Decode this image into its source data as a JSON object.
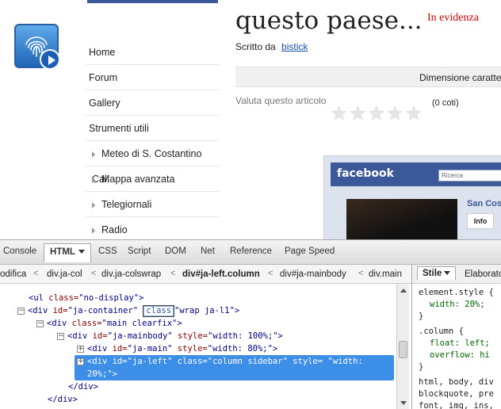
{
  "page": {
    "article_title": "questo paese...",
    "featured_label": "In evidenza",
    "author_prefix": "Scritto da",
    "author_name": "bistick",
    "font_size_label": "Dimensione caratte",
    "rating_label": "Valuta questo articolo",
    "rating_value": 0,
    "rating_max": 5,
    "votes_label": "(0 coti)",
    "menu": [
      {
        "label": "Home",
        "sub": false
      },
      {
        "label": "Forum",
        "sub": false
      },
      {
        "label": "Gallery",
        "sub": false
      },
      {
        "label": "Strumenti utili",
        "sub": false
      },
      {
        "label": "Meteo di S. Costantino Cal.",
        "sub": true
      },
      {
        "label": "Mappa avanzata",
        "sub": true
      },
      {
        "label": "Telegiornali",
        "sub": true
      },
      {
        "label": "Radio",
        "sub": true
      }
    ],
    "facebook": {
      "logo": "facebook",
      "search_placeholder": "Ricerca",
      "profile_name": "San Cos",
      "info_tab": "Info"
    }
  },
  "firebug": {
    "tabs": [
      "Console",
      "HTML",
      "CSS",
      "Script",
      "DOM",
      "Net",
      "Reference",
      "Page Speed"
    ],
    "active_tab": "HTML",
    "breadcrumbs": [
      "odifica",
      "div.ja-col",
      "div.ja-colswrap",
      "div#ja-left.column",
      "div#ja-mainbody",
      "div.main"
    ],
    "current_crumb": "div#ja-left.column",
    "side_tabs": [
      "Stile",
      "Elaborato"
    ],
    "active_side_tab": "Stile",
    "html_lines": [
      {
        "t1": "<ul ",
        "a1": "class=",
        "v1": "\"no-display\"",
        "end": ">"
      },
      {
        "t1": "<div ",
        "a1": "id=",
        "v1": "\"ja-container\"",
        "edit": "class",
        "v2": "\"wrap ja-l1\"",
        "end": ">"
      },
      {
        "t1": "<div ",
        "a1": "class=",
        "v1": "\"main clearfix\"",
        "end": ">"
      },
      {
        "t1": "<div ",
        "a1": "id=",
        "v1": "\"ja-mainbody\"",
        "a2": " style=",
        "v2": "\"width: 100%;\"",
        "end": ">"
      },
      {
        "t1": "<div ",
        "a1": "id=",
        "v1": "\"ja-main\"",
        "a2": " style=",
        "v2": "\"width: 80%;\"",
        "end": ">"
      },
      {
        "t1": "<div ",
        "a1": "id=",
        "v1": "\"ja-left\"",
        "a2": " class=",
        "v2": "\"column sidebar\"",
        "a3": " style=",
        "v3": "\"width:",
        "end2": "20%;\">"
      },
      {
        "close": "</div>"
      },
      {
        "close": "</div>"
      }
    ],
    "css_lines": [
      "element.style {",
      "width: 20%;",
      "}",
      ".column {",
      "float: left;",
      "overflow: hi",
      "}",
      "html, body, div",
      "blockquote, pre",
      "font, img, ins,"
    ]
  },
  "colors": {
    "selection": "#3d8ee6",
    "facebook_blue": "#3b5998",
    "featured_red": "#cc0000",
    "link_blue": "#1a4fa0"
  },
  "icons": [
    "fingerprint-play-icon",
    "star-icon",
    "expand-icon",
    "collapse-icon",
    "dropdown-arrow-icon",
    "scroll-up-icon",
    "scroll-down-icon"
  ]
}
